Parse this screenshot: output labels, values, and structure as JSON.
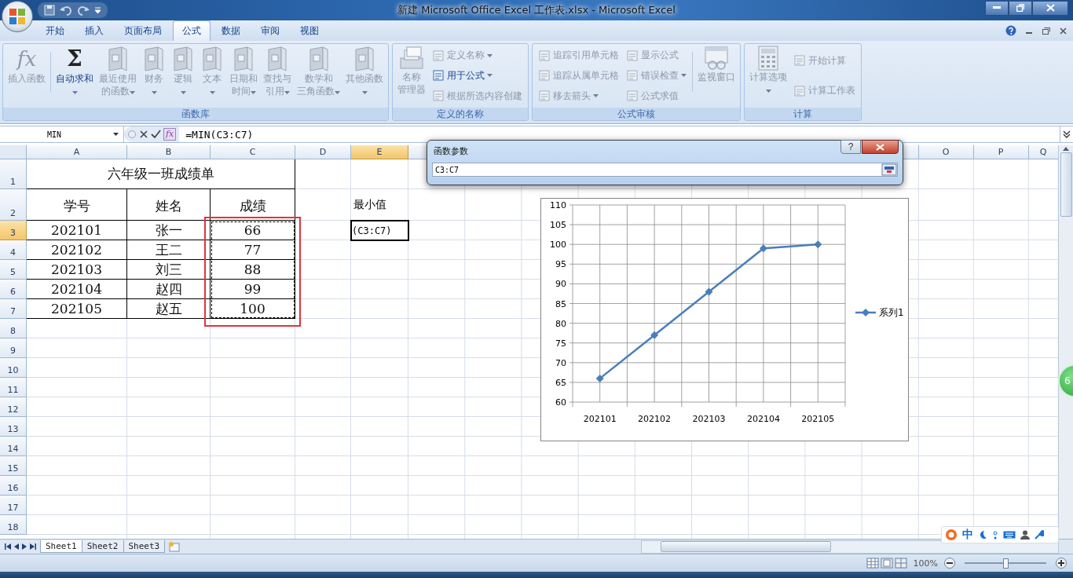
{
  "title_bar": {
    "title": "新建 Microsoft Office Excel 工作表.xlsx - Microsoft Excel"
  },
  "tabs": [
    {
      "label": "开始",
      "selected": false
    },
    {
      "label": "插入",
      "selected": false
    },
    {
      "label": "页面布局",
      "selected": false
    },
    {
      "label": "公式",
      "selected": true
    },
    {
      "label": "数据",
      "selected": false
    },
    {
      "label": "审阅",
      "selected": false
    },
    {
      "label": "视图",
      "selected": false
    }
  ],
  "ribbon": {
    "groups": [
      {
        "title": "函数库",
        "columns": [
          {
            "kind": "large",
            "glyph": "fx",
            "label": [
              "插入函数"
            ],
            "disabled": true,
            "dropdown": false
          },
          {
            "kind": "separator"
          },
          {
            "kind": "large",
            "glyph": "Σ",
            "label": [
              "自动求和"
            ],
            "disabled": false,
            "dropdown": true
          },
          {
            "kind": "large",
            "label": [
              "最近使用",
              "的函数"
            ],
            "disabled": true,
            "dropdown": true
          },
          {
            "kind": "large",
            "label": [
              "财务"
            ],
            "disabled": true,
            "dropdown": true
          },
          {
            "kind": "large",
            "label": [
              "逻辑"
            ],
            "disabled": true,
            "dropdown": true
          },
          {
            "kind": "large",
            "label": [
              "文本"
            ],
            "disabled": true,
            "dropdown": true
          },
          {
            "kind": "large",
            "label": [
              "日期和",
              "时间"
            ],
            "disabled": true,
            "dropdown": true
          },
          {
            "kind": "large",
            "label": [
              "查找与",
              "引用"
            ],
            "disabled": true,
            "dropdown": true
          },
          {
            "kind": "large",
            "label": [
              "数学和",
              "三角函数"
            ],
            "disabled": true,
            "dropdown": true
          },
          {
            "kind": "large",
            "label": [
              "其他函数"
            ],
            "disabled": true,
            "dropdown": true
          }
        ]
      },
      {
        "title": "定义的名称",
        "columns": [
          {
            "kind": "large",
            "label": [
              "名称",
              "管理器"
            ],
            "disabled": true,
            "dropdown": false
          },
          {
            "kind": "small",
            "items": [
              {
                "label": "定义名称",
                "disabled": true,
                "dropdown": true
              },
              {
                "label": "用于公式",
                "disabled": false,
                "dropdown": true
              },
              {
                "label": "根据所选内容创建",
                "disabled": true,
                "dropdown": false
              }
            ]
          }
        ]
      },
      {
        "title": "公式审核",
        "columns": [
          {
            "kind": "small",
            "items": [
              {
                "label": "追踪引用单元格",
                "disabled": true,
                "dropdown": false
              },
              {
                "label": "追踪从属单元格",
                "disabled": true,
                "dropdown": false
              },
              {
                "label": "移去箭头",
                "disabled": true,
                "dropdown": true
              }
            ]
          },
          {
            "kind": "small",
            "items": [
              {
                "label": "显示公式",
                "disabled": true,
                "dropdown": false
              },
              {
                "label": "错误检查",
                "disabled": true,
                "dropdown": true
              },
              {
                "label": "公式求值",
                "disabled": true,
                "dropdown": false
              }
            ]
          },
          {
            "kind": "separator"
          },
          {
            "kind": "large",
            "label": [
              "监视窗口"
            ],
            "disabled": true,
            "dropdown": false
          }
        ]
      },
      {
        "title": "计算",
        "columns": [
          {
            "kind": "large",
            "label": [
              "计算选项"
            ],
            "disabled": true,
            "dropdown": true
          },
          {
            "kind": "small",
            "items": [
              {
                "label": "开始计算",
                "disabled": true,
                "dropdown": false
              },
              {
                "label": "计算工作表",
                "disabled": true,
                "dropdown": false
              }
            ]
          }
        ]
      }
    ]
  },
  "formula_bar": {
    "name_box": "MIN",
    "insert_function": "fx",
    "formula": "=MIN(C3:C7)"
  },
  "sheet": {
    "columns": [
      {
        "label": "A",
        "selected": false
      },
      {
        "label": "B",
        "selected": false
      },
      {
        "label": "C",
        "selected": false
      },
      {
        "label": "D",
        "selected": false
      },
      {
        "label": "E",
        "selected": true
      }
    ],
    "right_columns": [
      {
        "label": "O",
        "selected": false
      },
      {
        "label": "P",
        "selected": false
      },
      {
        "label": "Q",
        "selected": false
      }
    ],
    "rows": [
      {
        "label": "1",
        "selected": false
      },
      {
        "label": "2",
        "selected": false
      },
      {
        "label": "3",
        "selected": true
      },
      {
        "label": "4",
        "selected": false
      },
      {
        "label": "5",
        "selected": false
      },
      {
        "label": "6",
        "selected": false
      },
      {
        "label": "7",
        "selected": false
      },
      {
        "label": "8",
        "selected": false
      },
      {
        "label": "9",
        "selected": false
      },
      {
        "label": "10",
        "selected": false
      },
      {
        "label": "11",
        "selected": false
      },
      {
        "label": "12",
        "selected": false
      },
      {
        "label": "13",
        "selected": false
      },
      {
        "label": "14",
        "selected": false
      },
      {
        "label": "15",
        "selected": false
      },
      {
        "label": "16",
        "selected": false
      },
      {
        "label": "17",
        "selected": false
      },
      {
        "label": "18",
        "selected": false
      }
    ],
    "title": "六年级一班成绩单",
    "headers": [
      "学号",
      "姓名",
      "成绩"
    ],
    "records": [
      [
        "202101",
        "张一",
        "66"
      ],
      [
        "202102",
        "王二",
        "77"
      ],
      [
        "202103",
        "刘三",
        "88"
      ],
      [
        "202104",
        "赵四",
        "99"
      ],
      [
        "202105",
        "赵五",
        "100"
      ]
    ],
    "copy_marquee": true,
    "result_label": "最小值",
    "editing_cell": "(C3:C7)"
  },
  "dialog": {
    "title": "函数参数",
    "help": "?",
    "value": "C3:C7"
  },
  "chart": {
    "chart_data": {
      "type": "line",
      "categories": [
        "202101",
        "202102",
        "202103",
        "202104",
        "202105"
      ],
      "series": [
        {
          "name": "系列1",
          "color": "#4a7ebb",
          "values": [
            66,
            77,
            88,
            99,
            100
          ],
          "marker": "diamond"
        }
      ],
      "grid": true,
      "ylim": [
        60,
        110
      ],
      "yticks": [
        60,
        65,
        70,
        75,
        80,
        85,
        90,
        95,
        100,
        105,
        110
      ]
    }
  },
  "sheet_tabs": [
    {
      "label": "Sheet1",
      "selected": true
    },
    {
      "label": "Sheet2",
      "selected": false
    },
    {
      "label": "Sheet3",
      "selected": false
    }
  ],
  "ime_bar": {
    "mode": "中"
  },
  "floating_badge": {
    "text": "6"
  },
  "status_bar": {
    "zoom": {
      "text": "100%",
      "level": 0.5
    }
  }
}
